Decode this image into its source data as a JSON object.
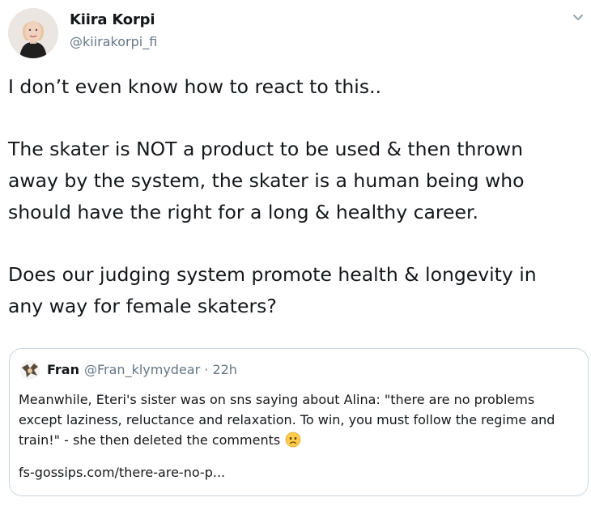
{
  "author": {
    "name": "Kiira Korpi",
    "handle": "@kiirakorpi_fi"
  },
  "tweet": {
    "lines": [
      "I don’t even know how to react to this..",
      "The skater is NOT a product to be used & then thrown",
      "away by the system, the skater is a human being who",
      "should have the right for a long & healthy career.",
      "Does our judging system promote health & longevity in",
      "any way for female skaters?"
    ]
  },
  "quoted": {
    "name": "Fran",
    "handle_time": "@Fran_klymydear · 22h",
    "lines": [
      "Meanwhile, Eteri's sister was on sns saying about Alina: \"there are no problems",
      "except laziness, reluctance and relaxation. To win, you must follow the regime and",
      "train!\" - she then deleted the comments"
    ],
    "link": "fs-gossips.com/there-are-no-p..."
  },
  "icons": {
    "caret": "chevron-down-icon",
    "emoji": "frowning-face-emoji"
  },
  "colors": {
    "text": "#14171a",
    "secondary": "#657786",
    "border": "#ccd6dd"
  }
}
